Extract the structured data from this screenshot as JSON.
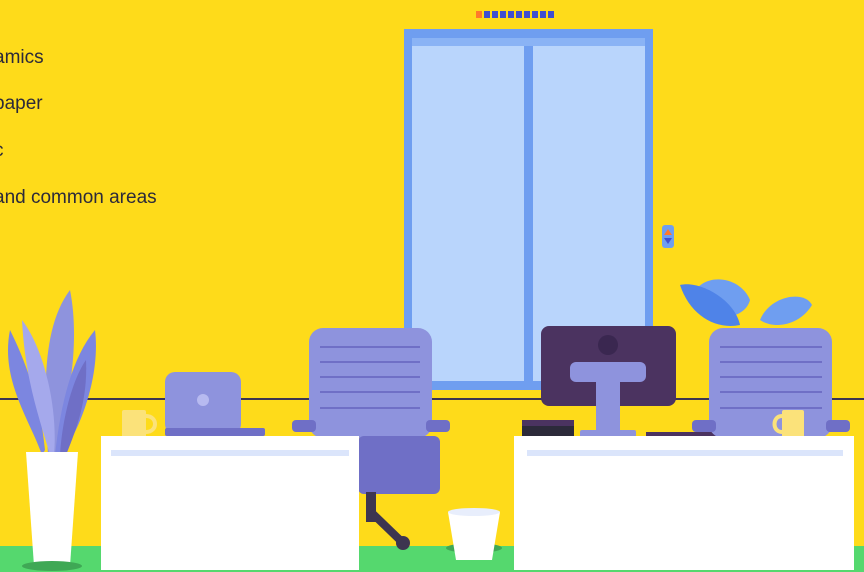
{
  "text_lines": [
    "amics",
    "paper",
    "c",
    "and common areas"
  ],
  "progress_dots": {
    "total": 10,
    "active_index": 0
  },
  "colors": {
    "background": "#fedb1a",
    "floor": "#55d86e",
    "door_frame": "#6f9ef0",
    "door_glass": "#b9d5fc",
    "chair": "#8e93dd",
    "chair_dark": "#6f6fc6",
    "monitor": "#4b3360",
    "desk": "#ffffff",
    "mug": "#fbe27a",
    "plant_leaf": "#7c86e0",
    "active_dot": "#ff7a2a",
    "dot": "#3f4fd0"
  },
  "icons": [
    "elevator-up-down-icon",
    "monitor-logo-icon"
  ]
}
